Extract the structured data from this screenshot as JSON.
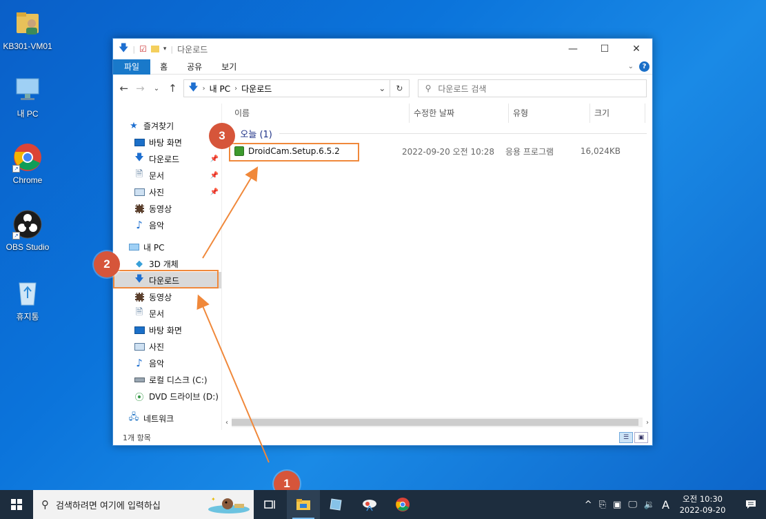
{
  "desktop": {
    "icons": [
      {
        "label": "KB301-VM01",
        "icon": "user-folder-icon"
      },
      {
        "label": "내 PC",
        "icon": "this-pc-icon"
      },
      {
        "label": "Chrome",
        "icon": "chrome-icon"
      },
      {
        "label": "OBS Studio",
        "icon": "obs-icon"
      },
      {
        "label": "휴지통",
        "icon": "recycle-bin-icon"
      }
    ]
  },
  "window": {
    "title": "다운로드",
    "controls": [
      "minimize",
      "maximize",
      "close"
    ],
    "ribbon_tabs": [
      "파일",
      "홈",
      "공유",
      "보기"
    ],
    "address": {
      "segments": [
        "내 PC",
        "다운로드"
      ]
    },
    "search_placeholder": "다운로드 검색",
    "nav": {
      "quick_access": "즐겨찾기",
      "quick_items": [
        {
          "label": "바탕 화면",
          "icon": "desktop-icon"
        },
        {
          "label": "다운로드",
          "icon": "download-icon",
          "pinned": true
        },
        {
          "label": "문서",
          "icon": "document-icon",
          "pinned": true
        },
        {
          "label": "사진",
          "icon": "pictures-icon",
          "pinned": true
        },
        {
          "label": "동영상",
          "icon": "videos-icon"
        },
        {
          "label": "음악",
          "icon": "music-icon"
        }
      ],
      "this_pc": "내 PC",
      "pc_items": [
        {
          "label": "3D 개체",
          "icon": "3d-objects-icon"
        },
        {
          "label": "다운로드",
          "icon": "download-icon",
          "selected": true
        },
        {
          "label": "동영상",
          "icon": "videos-icon"
        },
        {
          "label": "문서",
          "icon": "document-icon"
        },
        {
          "label": "바탕 화면",
          "icon": "desktop-icon"
        },
        {
          "label": "사진",
          "icon": "pictures-icon"
        },
        {
          "label": "음악",
          "icon": "music-icon"
        },
        {
          "label": "로컬 디스크 (C:)",
          "icon": "drive-icon"
        },
        {
          "label": "DVD 드라이브 (D:)",
          "icon": "dvd-icon"
        }
      ],
      "network": "네트워크"
    },
    "columns": [
      "이름",
      "수정한 날짜",
      "유형",
      "크기"
    ],
    "group": "오늘 (1)",
    "files": [
      {
        "name": "DroidCam.Setup.6.5.2",
        "modified": "2022-09-20 오전 10:28",
        "type": "응용 프로그램",
        "size": "16,024KB"
      }
    ],
    "status": "1개 항목"
  },
  "annotations": [
    "1",
    "2",
    "3"
  ],
  "colors": {
    "accent": "#f0883a",
    "badge": "#d6553a",
    "taskbar": "#1d2d3e"
  },
  "taskbar": {
    "search_placeholder": "검색하려면 여기에 입력하십",
    "tray_lang": "A",
    "time": "오전 10:30",
    "date": "2022-09-20"
  }
}
